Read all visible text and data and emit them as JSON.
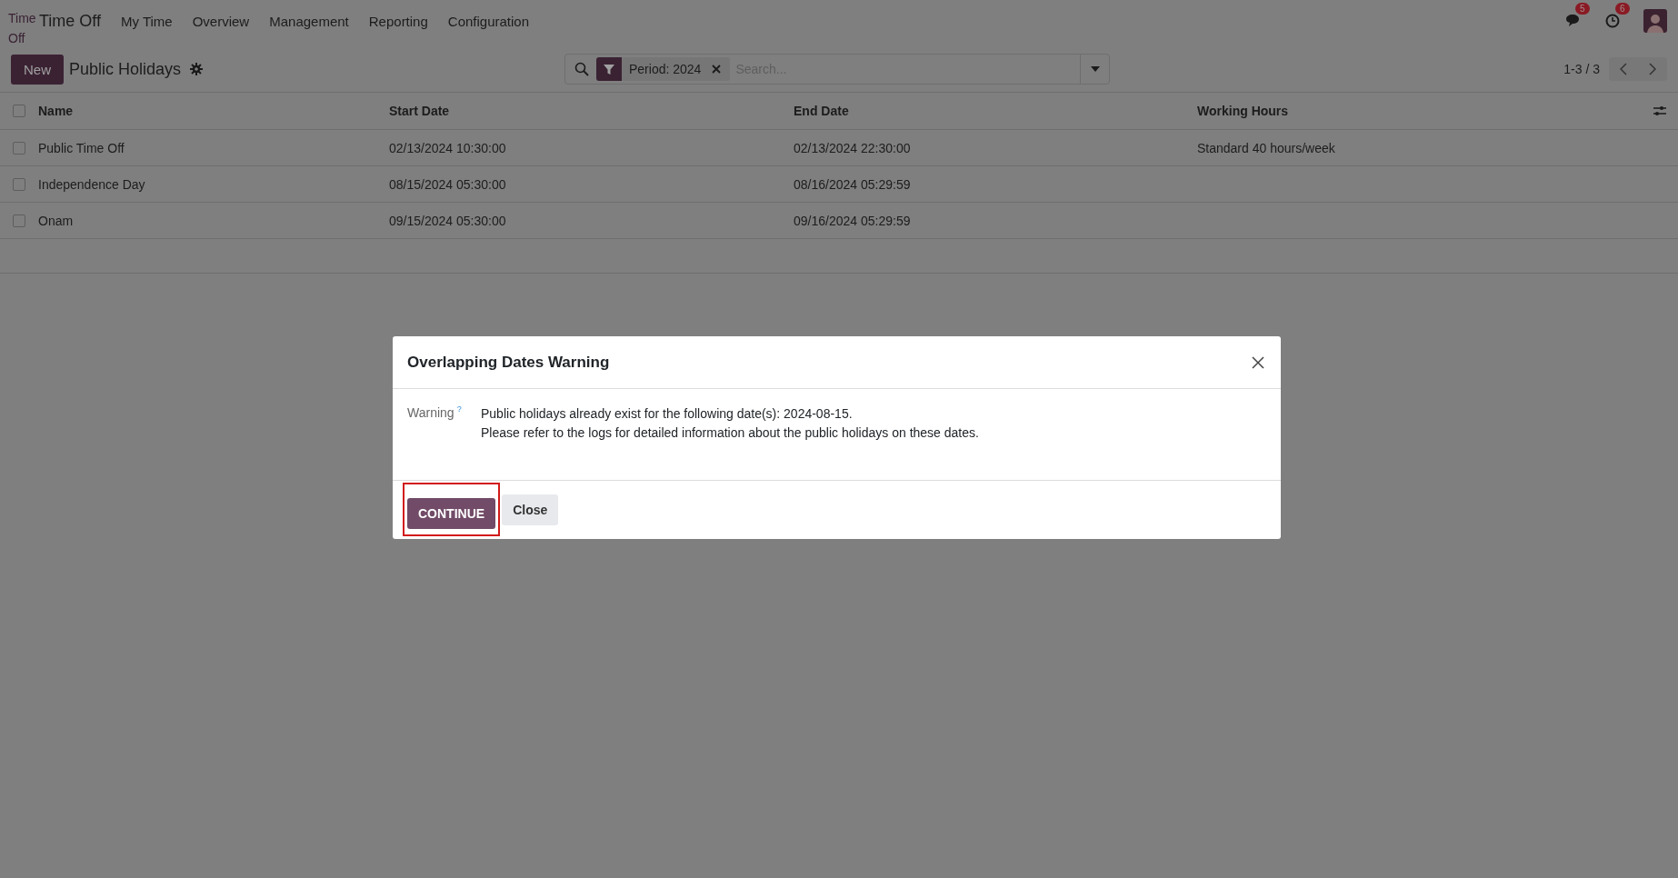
{
  "navbar": {
    "logo_text": "Time Off",
    "app_name": "Time Off",
    "menu": [
      {
        "label": "My Time"
      },
      {
        "label": "Overview"
      },
      {
        "label": "Management"
      },
      {
        "label": "Reporting"
      },
      {
        "label": "Configuration"
      }
    ],
    "systray": [
      {
        "kind": "chat",
        "count": "5"
      },
      {
        "kind": "activity",
        "count": "6"
      }
    ]
  },
  "control_panel": {
    "new_button": "New",
    "title": "Public Holidays",
    "search": {
      "facet": "Period: 2024",
      "placeholder": "Search..."
    },
    "pager": "1-3 / 3"
  },
  "table": {
    "columns": [
      "Name",
      "Start Date",
      "End Date",
      "Working Hours"
    ],
    "header_selected": false,
    "rows": [
      {
        "selected": false,
        "cells": [
          "Public Time Off",
          "02/13/2024 10:30:00",
          "02/13/2024 22:30:00",
          "Standard 40 hours/week"
        ]
      },
      {
        "selected": false,
        "cells": [
          "Independence Day",
          "08/15/2024 05:30:00",
          "08/16/2024 05:29:59",
          ""
        ]
      },
      {
        "selected": false,
        "cells": [
          "Onam",
          "09/15/2024 05:30:00",
          "09/16/2024 05:29:59",
          ""
        ]
      }
    ]
  },
  "dialog": {
    "title": "Overlapping Dates Warning",
    "field_label": "Warning",
    "help_mark": "?",
    "message_lines": [
      "Public holidays already exist for the following date(s): 2024-08-15.",
      "Please refer to the logs for detailed information about the public holidays on these dates."
    ],
    "buttons": [
      {
        "label": "CONTINUE",
        "kind": "primary",
        "highlighted": true
      },
      {
        "label": "Close",
        "kind": "secondary",
        "highlighted": false
      }
    ]
  }
}
